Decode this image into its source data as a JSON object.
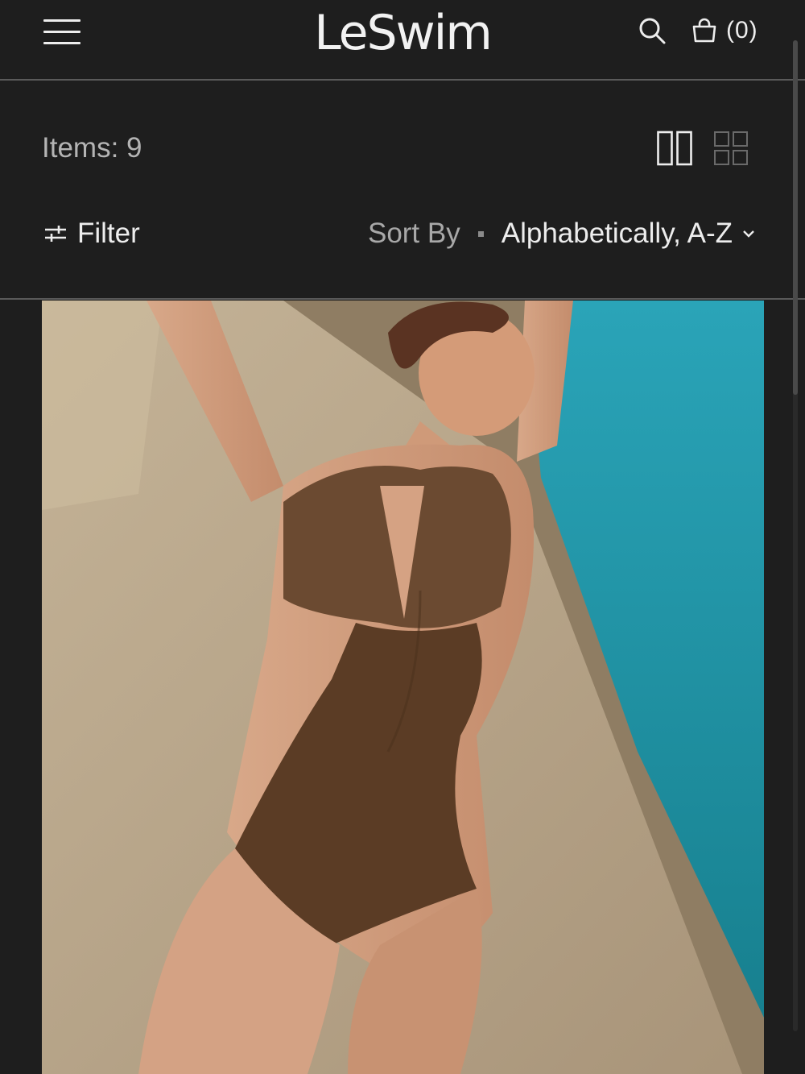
{
  "header": {
    "brand": "LeSwim",
    "cart_count": "(0)"
  },
  "toolbar": {
    "items_count": "Items: 9",
    "filter_label": "Filter",
    "sort_label": "Sort By",
    "sort_value": "Alphabetically, A-Z",
    "active_view": "2-column"
  },
  "product": {
    "image": "model-in-brown-one-piece-swimsuit-by-pool"
  },
  "colors": {
    "background": "#1e1e1e",
    "divider": "#5a5a5a",
    "text": "#ededed",
    "muted_text": "#b4b4b4",
    "pool": "#1d8fa3",
    "swimsuit": "#5a3b24",
    "stone": "#b8a68b"
  }
}
